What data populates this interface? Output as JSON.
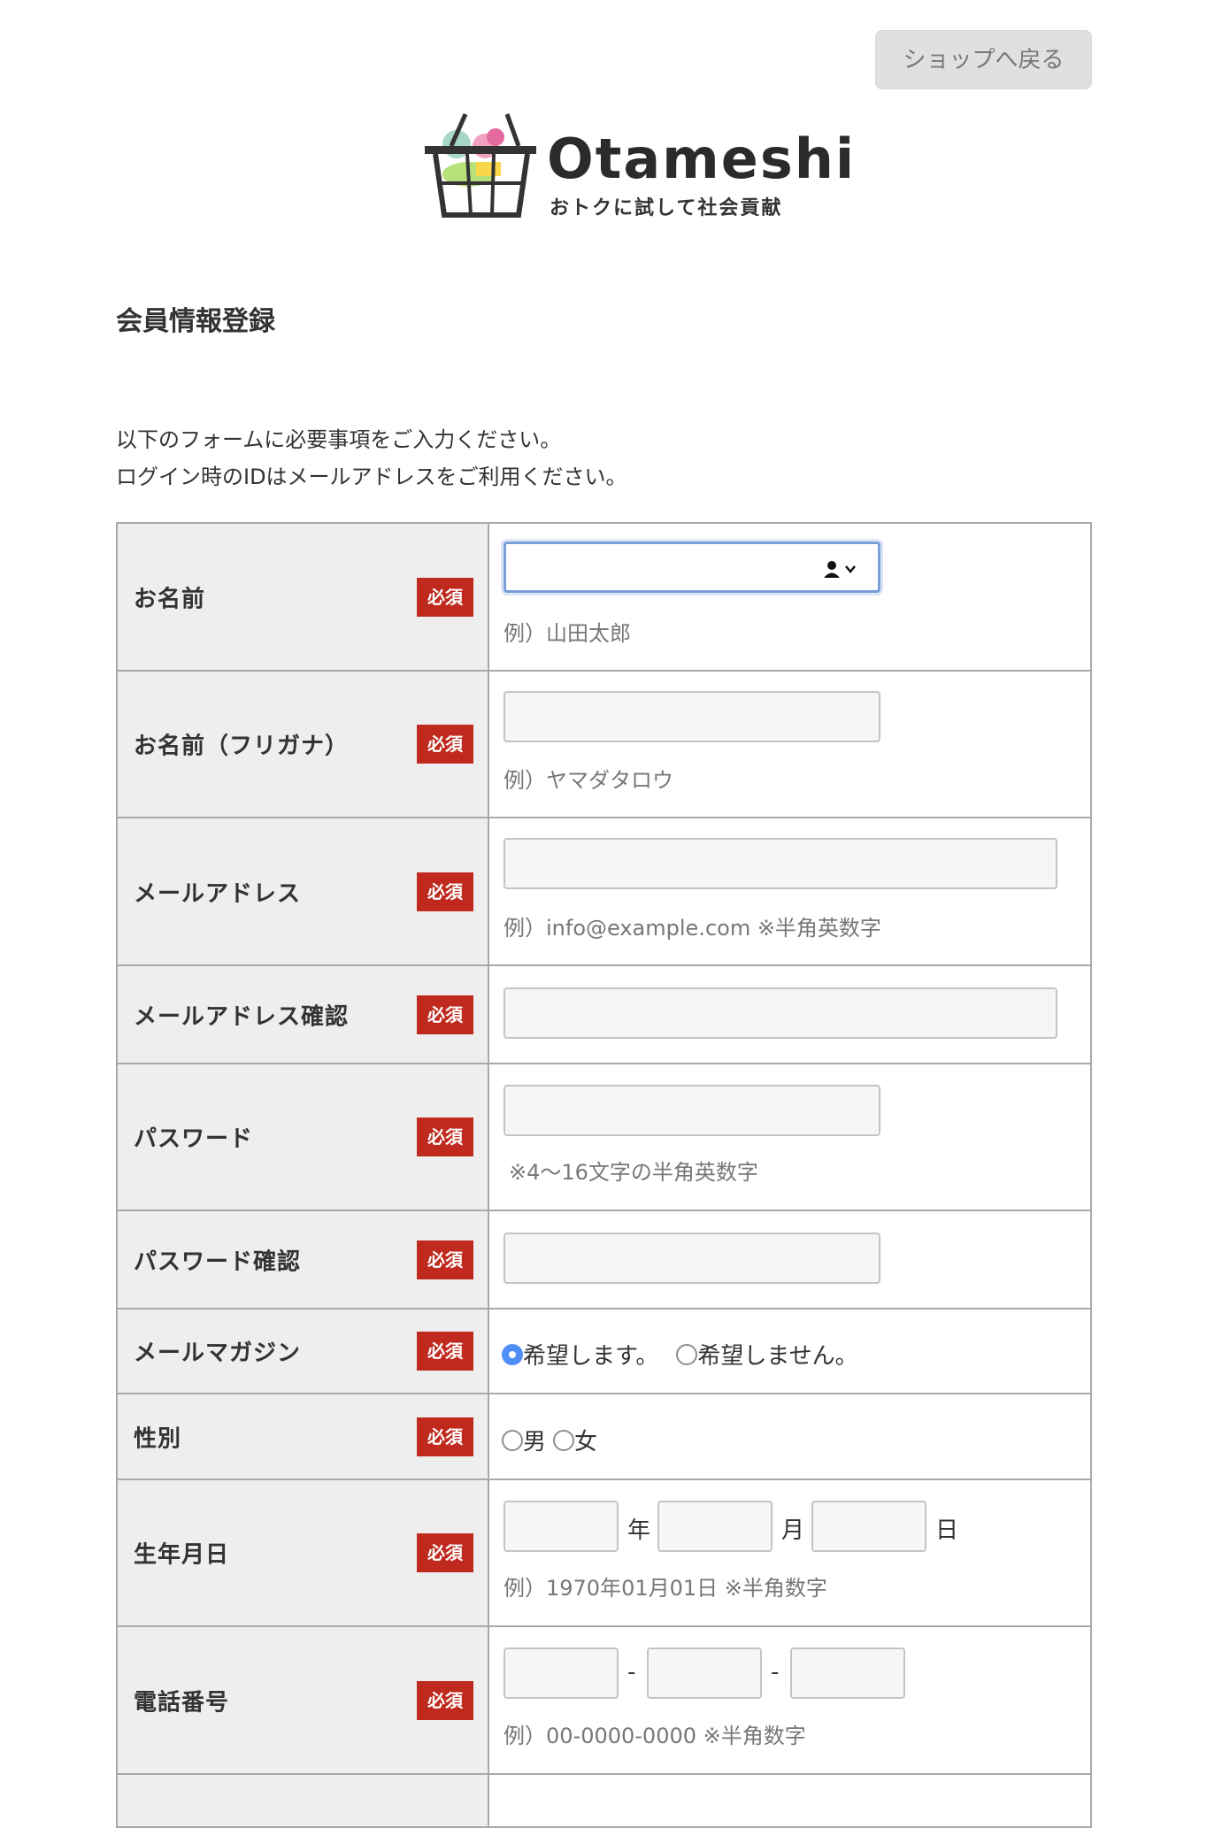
{
  "header": {
    "back_button": "ショップへ戻る",
    "logo_word": "Otameshi",
    "logo_tagline": "おトクに試して社会貢献"
  },
  "page_title": "会員情報登録",
  "intro": {
    "line1": "以下のフォームに必要事項をご入力ください。",
    "line2": "ログイン時のIDはメールアドレスをご利用ください。"
  },
  "required_badge": "必須",
  "fields": {
    "name": {
      "label": "お名前",
      "value": "",
      "hint": "例）山田太郎"
    },
    "kana": {
      "label": "お名前（フリガナ）",
      "value": "",
      "hint": "例）ヤマダタロウ"
    },
    "email": {
      "label": "メールアドレス",
      "value": "",
      "hint": "例）info@example.com ※半角英数字"
    },
    "email_confirm": {
      "label": "メールアドレス確認",
      "value": ""
    },
    "password": {
      "label": "パスワード",
      "value": "",
      "hint": "※4〜16文字の半角英数字"
    },
    "password_confirm": {
      "label": "パスワード確認",
      "value": ""
    },
    "magazine": {
      "label": "メールマガジン",
      "option_yes": "希望します。",
      "option_no": "希望しません。",
      "selected": "yes"
    },
    "gender": {
      "label": "性別",
      "option_male": "男",
      "option_female": "女"
    },
    "birthday": {
      "label": "生年月日",
      "unit_year": "年",
      "unit_month": "月",
      "unit_day": "日",
      "hint": "例）1970年01月01日 ※半角数字"
    },
    "phone": {
      "label": "電話番号",
      "separator": "-",
      "hint": "例）00-0000-0000 ※半角数字"
    }
  },
  "colors": {
    "required_badge": "#c0291d",
    "label_bg": "#eeeeee",
    "radio_selected": "#4f8ef7"
  }
}
